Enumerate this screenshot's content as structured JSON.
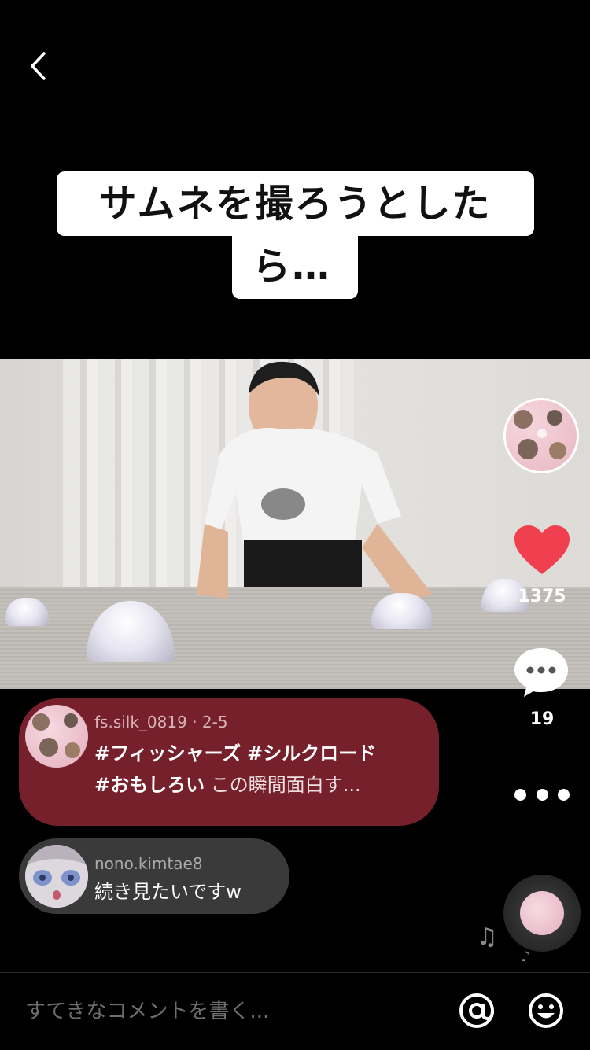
{
  "caption": {
    "line1": "サムネを撮ろうとした",
    "line2": "ら…"
  },
  "actions": {
    "like_count": "1375",
    "comment_count": "19"
  },
  "description": {
    "username": "fs.silk_0819 · 2-5",
    "hashtag1": "#フィッシャーズ",
    "hashtag2": "#シルクロード",
    "hashtag3": "#おもしろい",
    "text": "この瞬間面白す..."
  },
  "comment": {
    "username": "nono.kimtae8",
    "text": "続き見たいですw"
  },
  "input": {
    "placeholder": "すてきなコメントを書く..."
  },
  "icons": {
    "back": "back-chevron-icon",
    "like": "heart-icon",
    "comment": "comment-bubble-icon",
    "more": "more-dots-icon",
    "music": "music-note-icon",
    "mention": "at-sign-icon",
    "emoji": "smiley-icon"
  },
  "colors": {
    "like": "#f0404f",
    "description_bubble": "#76202c",
    "comment_bubble": "#3a3a3a"
  }
}
